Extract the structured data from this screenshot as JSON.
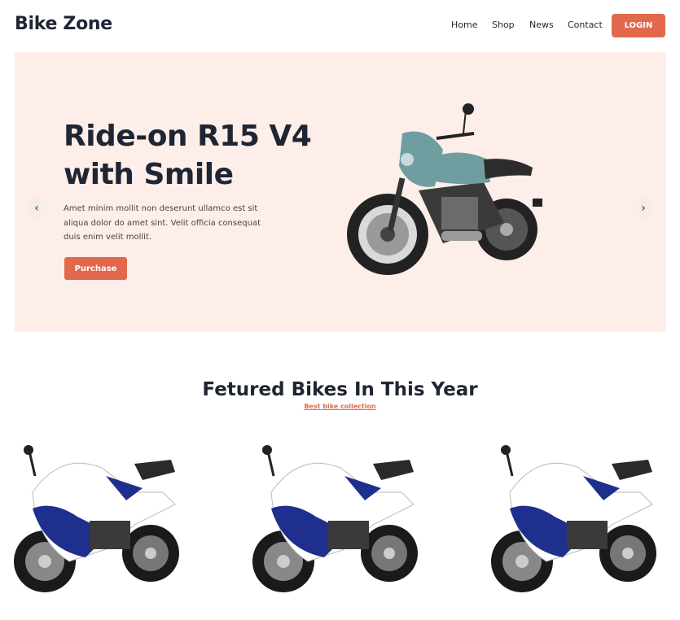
{
  "brand": "Bike Zone",
  "nav": {
    "items": [
      "Home",
      "Shop",
      "News",
      "Contact"
    ],
    "login_label": "LOGIN"
  },
  "hero": {
    "title_line1": "Ride-on R15 V4",
    "title_line2": "with Smile",
    "description": "Amet minim mollit non deserunt ullamco est sit aliqua dolor do amet sint. Velit officia consequat duis enim velit mollit.",
    "purchase_label": "Purchase",
    "prev_icon": "‹",
    "next_icon": "›",
    "bike_colors": {
      "fairing": "#6f9ea0",
      "tire": "#222222",
      "engine": "#3a3a3a"
    }
  },
  "featured": {
    "title": "Fetured Bikes In This Year",
    "subtitle": "Best bike collection",
    "bike_colors": {
      "primary": "#1f2f8e",
      "secondary": "#ffffff",
      "tire": "#1a1a1a"
    }
  },
  "colors": {
    "accent": "#e2684b",
    "hero_bg": "#fdeeea",
    "text": "#1f2533"
  }
}
